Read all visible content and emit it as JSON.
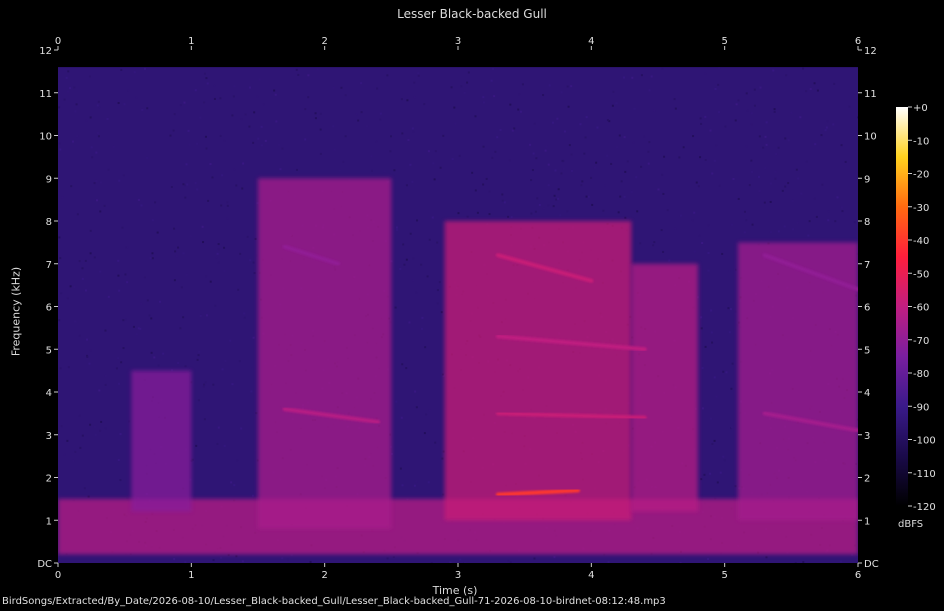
{
  "chart_data": {
    "type": "heatmap",
    "title": "Lesser Black-backed Gull",
    "xlabel": "Time (s)",
    "ylabel": "Frequency (kHz)",
    "xlim": [
      0,
      6
    ],
    "ylim": [
      0,
      12
    ],
    "x_ticks": [
      "0",
      "1",
      "2",
      "3",
      "4",
      "5",
      "6"
    ],
    "y_ticks": [
      "DC",
      "1",
      "2",
      "3",
      "4",
      "5",
      "6",
      "7",
      "8",
      "9",
      "10",
      "11",
      "12"
    ],
    "colorbar": {
      "unit": "dBFS",
      "range": [
        -120,
        0
      ],
      "ticks": [
        "+0",
        "-10",
        "-20",
        "-30",
        "-40",
        "-50",
        "-60",
        "-70",
        "-80",
        "-90",
        "-100",
        "-110",
        "-120"
      ],
      "colormap": [
        "#000000",
        "#1a0a4a",
        "#3a1a8a",
        "#7a1ea0",
        "#c01e80",
        "#ff1e3c",
        "#ff6a10",
        "#ffd21e",
        "#ffffff"
      ]
    },
    "background": "#000000",
    "noise_level_dbfs": -95,
    "strong_regions": [
      {
        "label": "low-frequency band",
        "t": [
          0.0,
          6.0
        ],
        "f": [
          0.2,
          1.5
        ],
        "dbfs": -62
      },
      {
        "label": "call 1",
        "t": [
          0.55,
          1.0
        ],
        "f": [
          1.2,
          4.5
        ],
        "dbfs": -72
      },
      {
        "label": "call 2",
        "t": [
          1.5,
          2.5
        ],
        "f": [
          0.8,
          9.0
        ],
        "dbfs": -65
      },
      {
        "label": "call 3",
        "t": [
          2.9,
          4.3
        ],
        "f": [
          1.0,
          8.0
        ],
        "dbfs": -58
      },
      {
        "label": "call 4",
        "t": [
          4.3,
          4.8
        ],
        "f": [
          1.2,
          7.0
        ],
        "dbfs": -62
      },
      {
        "label": "call 5",
        "t": [
          5.1,
          6.0
        ],
        "f": [
          1.0,
          7.5
        ],
        "dbfs": -66
      }
    ],
    "harmonic_tracks": [
      {
        "t": [
          0.05,
          0.3
        ],
        "f": [
          1.7,
          1.7
        ],
        "dbfs": -60
      },
      {
        "t": [
          0.05,
          0.3
        ],
        "f": [
          3.4,
          3.4
        ],
        "dbfs": -72
      },
      {
        "t": [
          0.05,
          0.3
        ],
        "f": [
          5.2,
          5.2
        ],
        "dbfs": -78
      },
      {
        "t": [
          1.65,
          2.4
        ],
        "f": [
          1.0,
          1.0
        ],
        "dbfs": -55
      },
      {
        "t": [
          1.7,
          2.4
        ],
        "f": [
          3.6,
          3.3
        ],
        "dbfs": -62
      },
      {
        "t": [
          1.7,
          2.1
        ],
        "f": [
          7.4,
          7.0
        ],
        "dbfs": -70
      },
      {
        "t": [
          3.3,
          3.9
        ],
        "f": [
          1.6,
          1.7
        ],
        "dbfs": -40
      },
      {
        "t": [
          3.3,
          4.4
        ],
        "f": [
          3.5,
          3.4
        ],
        "dbfs": -58
      },
      {
        "t": [
          3.3,
          4.4
        ],
        "f": [
          5.3,
          5.0
        ],
        "dbfs": -60
      },
      {
        "t": [
          3.3,
          4.0
        ],
        "f": [
          7.2,
          6.6
        ],
        "dbfs": -58
      },
      {
        "t": [
          4.2,
          4.75
        ],
        "f": [
          1.6,
          1.6
        ],
        "dbfs": -48
      },
      {
        "t": [
          5.3,
          6.0
        ],
        "f": [
          3.5,
          3.1
        ],
        "dbfs": -66
      },
      {
        "t": [
          5.3,
          6.0
        ],
        "f": [
          7.2,
          6.4
        ],
        "dbfs": -70
      }
    ]
  },
  "footer": "BirdSongs/Extracted/By_Date/2026-08-10/Lesser_Black-backed_Gull/Lesser_Black-backed_Gull-71-2026-08-10-birdnet-08:12:48.mp3"
}
